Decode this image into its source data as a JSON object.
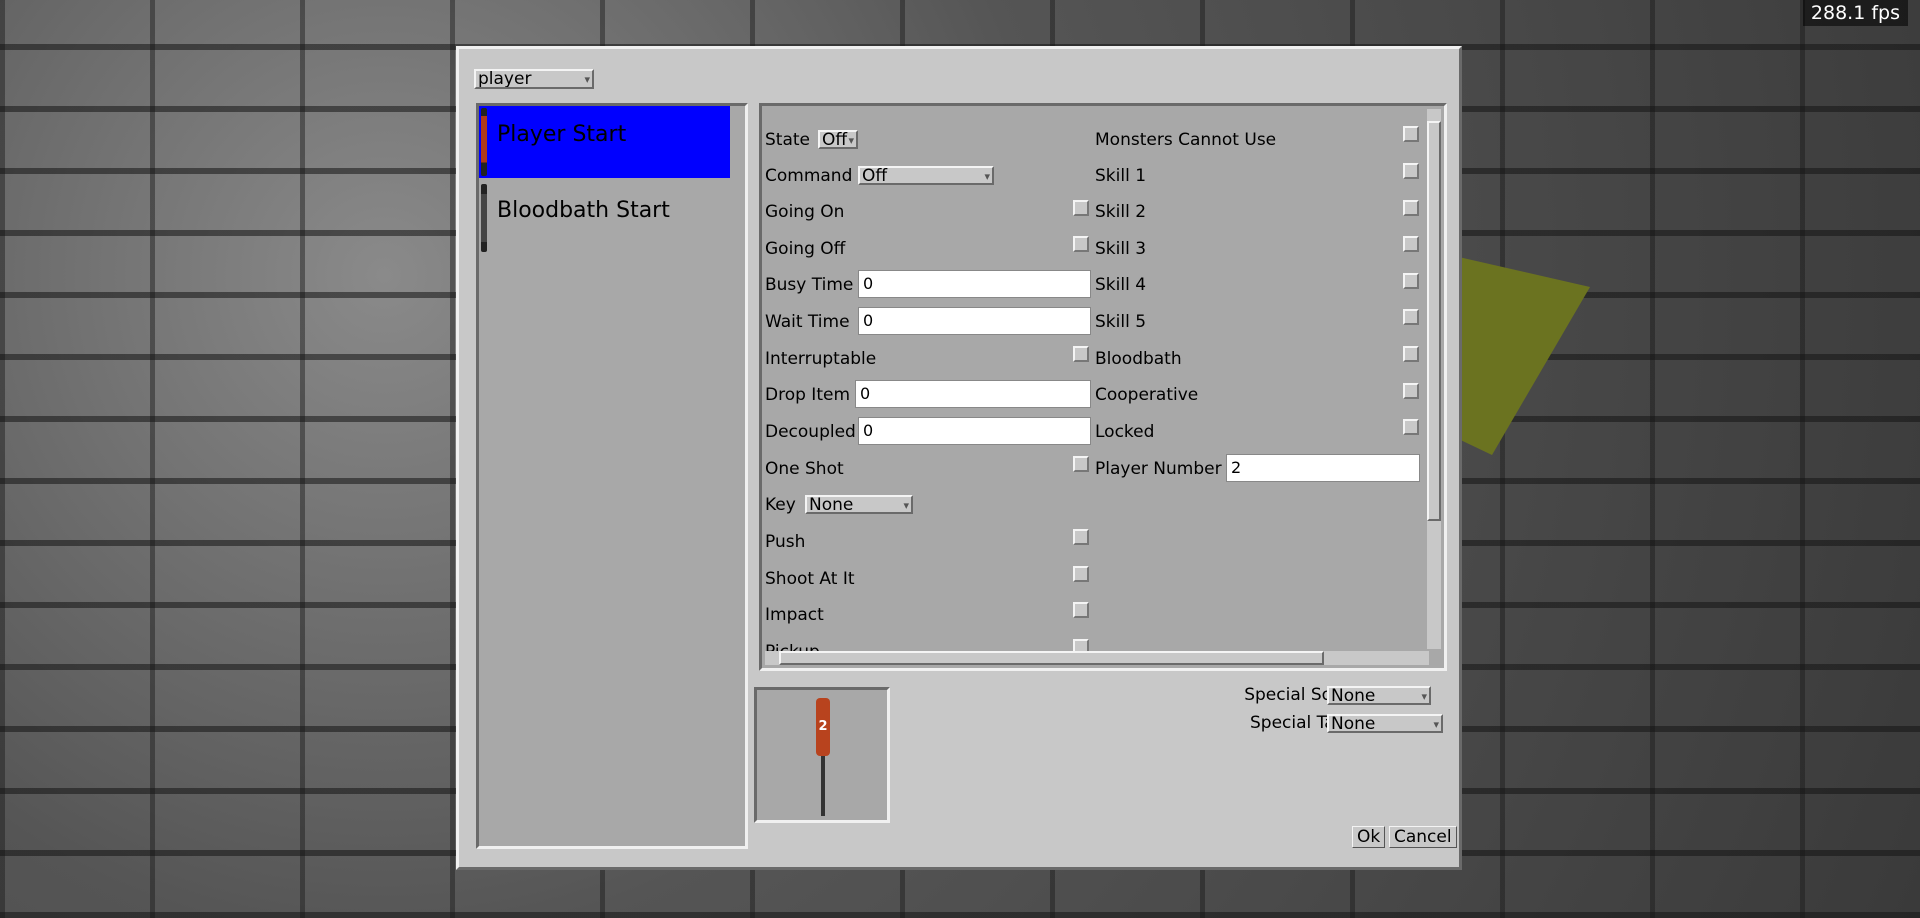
{
  "fps": "288.1 fps",
  "dialog": {
    "type_selector": "player",
    "entity_list": [
      {
        "label": "Player Start",
        "selected": true
      },
      {
        "label": "Bloodbath Start",
        "selected": false
      }
    ],
    "left_props": {
      "state": {
        "label": "State",
        "value": "Off"
      },
      "command": {
        "label": "Command",
        "value": "Off"
      },
      "going_on": "Going On",
      "going_off": "Going Off",
      "busy_time": {
        "label": "Busy Time",
        "value": "0"
      },
      "wait_time": {
        "label": "Wait Time",
        "value": "0"
      },
      "interruptable": "Interruptable",
      "drop_item": {
        "label": "Drop Item",
        "value": "0"
      },
      "decoupled": {
        "label": "Decoupled",
        "value": "0"
      },
      "one_shot": "One Shot",
      "key": {
        "label": "Key",
        "value": "None"
      },
      "push": "Push",
      "shoot_at_it": "Shoot At It",
      "impact": "Impact",
      "pickup": "Pickup"
    },
    "right_props": {
      "monsters_cannot_use": "Monsters Cannot Use",
      "skill1": "Skill 1",
      "skill2": "Skill 2",
      "skill3": "Skill 3",
      "skill4": "Skill 4",
      "skill5": "Skill 5",
      "bloodbath": "Bloodbath",
      "cooperative": "Cooperative",
      "locked": "Locked",
      "player_number": {
        "label": "Player Number",
        "value": "2"
      }
    },
    "preview_number": "2",
    "special_source": {
      "label": "Special Source:",
      "value": "None"
    },
    "special_target": {
      "label": "Special Target:",
      "value": "None"
    },
    "ok": "Ok",
    "cancel": "Cancel"
  }
}
